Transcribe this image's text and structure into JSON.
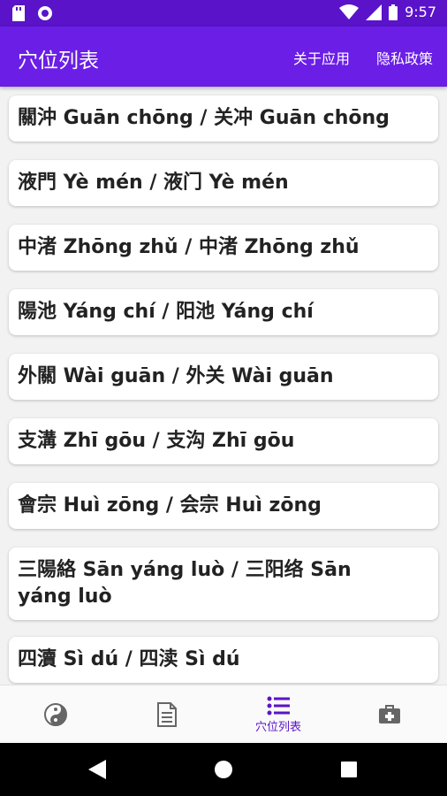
{
  "status_bar": {
    "time": "9:57"
  },
  "app_bar": {
    "title": "穴位列表",
    "about": "关于应用",
    "privacy": "隐私政策"
  },
  "items": [
    {
      "line1": "關沖 Guān chōng / 关冲 Guān chōng",
      "line2": ""
    },
    {
      "line1": "液門 Yè mén / 液门 Yè mén",
      "line2": ""
    },
    {
      "line1": "中渚 Zhōng zhǔ / 中渚 Zhōng zhǔ",
      "line2": ""
    },
    {
      "line1": "陽池 Yáng chí / 阳池 Yáng chí",
      "line2": ""
    },
    {
      "line1": "外關 Wài guān / 外关 Wài guān",
      "line2": ""
    },
    {
      "line1": "支溝 Zhī gōu / 支沟 Zhī gōu",
      "line2": ""
    },
    {
      "line1": "會宗 Huì zōng / 会宗 Huì zōng",
      "line2": ""
    },
    {
      "line1": "三陽絡 Sān yáng luò / 三阳络 Sān",
      "line2": "yáng luò"
    },
    {
      "line1": "四瀆 Sì dú / 四渎 Sì dú",
      "line2": ""
    }
  ],
  "bottom_nav": {
    "items": [
      {
        "icon": "yin-yang-icon",
        "label": ""
      },
      {
        "icon": "document-icon",
        "label": ""
      },
      {
        "icon": "list-icon",
        "label": "穴位列表"
      },
      {
        "icon": "medical-kit-icon",
        "label": ""
      }
    ]
  },
  "colors": {
    "primary": "#6a1ee6",
    "status": "#5a13c9"
  }
}
